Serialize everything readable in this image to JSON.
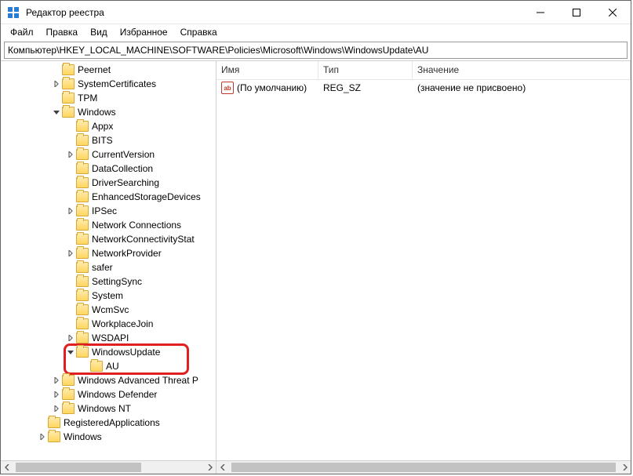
{
  "window": {
    "title": "Редактор реестра"
  },
  "menu": {
    "file": "Файл",
    "edit": "Правка",
    "view": "Вид",
    "favorites": "Избранное",
    "help": "Справка"
  },
  "address": "Компьютер\\HKEY_LOCAL_MACHINE\\SOFTWARE\\Policies\\Microsoft\\Windows\\WindowsUpdate\\AU",
  "tree": [
    {
      "depth": 0,
      "exp": "",
      "label": "Peernet"
    },
    {
      "depth": 0,
      "exp": ">",
      "label": "SystemCertificates"
    },
    {
      "depth": 0,
      "exp": "",
      "label": "TPM"
    },
    {
      "depth": 0,
      "exp": "v",
      "label": "Windows"
    },
    {
      "depth": 1,
      "exp": "",
      "label": "Appx"
    },
    {
      "depth": 1,
      "exp": "",
      "label": "BITS"
    },
    {
      "depth": 1,
      "exp": ">",
      "label": "CurrentVersion"
    },
    {
      "depth": 1,
      "exp": "",
      "label": "DataCollection"
    },
    {
      "depth": 1,
      "exp": "",
      "label": "DriverSearching"
    },
    {
      "depth": 1,
      "exp": "",
      "label": "EnhancedStorageDevices"
    },
    {
      "depth": 1,
      "exp": ">",
      "label": "IPSec"
    },
    {
      "depth": 1,
      "exp": "",
      "label": "Network Connections"
    },
    {
      "depth": 1,
      "exp": "",
      "label": "NetworkConnectivityStat"
    },
    {
      "depth": 1,
      "exp": ">",
      "label": "NetworkProvider"
    },
    {
      "depth": 1,
      "exp": "",
      "label": "safer"
    },
    {
      "depth": 1,
      "exp": "",
      "label": "SettingSync"
    },
    {
      "depth": 1,
      "exp": "",
      "label": "System"
    },
    {
      "depth": 1,
      "exp": "",
      "label": "WcmSvc"
    },
    {
      "depth": 1,
      "exp": "",
      "label": "WorkplaceJoin"
    },
    {
      "depth": 1,
      "exp": ">",
      "label": "WSDAPI"
    },
    {
      "depth": 1,
      "exp": "v",
      "label": "WindowsUpdate"
    },
    {
      "depth": 2,
      "exp": "",
      "label": "AU"
    },
    {
      "depth": 0,
      "exp": ">",
      "label": "Windows Advanced Threat P"
    },
    {
      "depth": 0,
      "exp": ">",
      "label": "Windows Defender"
    },
    {
      "depth": 0,
      "exp": ">",
      "label": "Windows NT"
    },
    {
      "depth": -1,
      "exp": "",
      "label": "RegisteredApplications"
    },
    {
      "depth": -1,
      "exp": ">",
      "label": "Windows"
    }
  ],
  "list": {
    "cols": {
      "name": "Имя",
      "type": "Тип",
      "value": "Значение"
    },
    "rows": [
      {
        "icon": "ab",
        "name": "(По умолчанию)",
        "type": "REG_SZ",
        "value": "(значение не присвоено)"
      }
    ]
  }
}
